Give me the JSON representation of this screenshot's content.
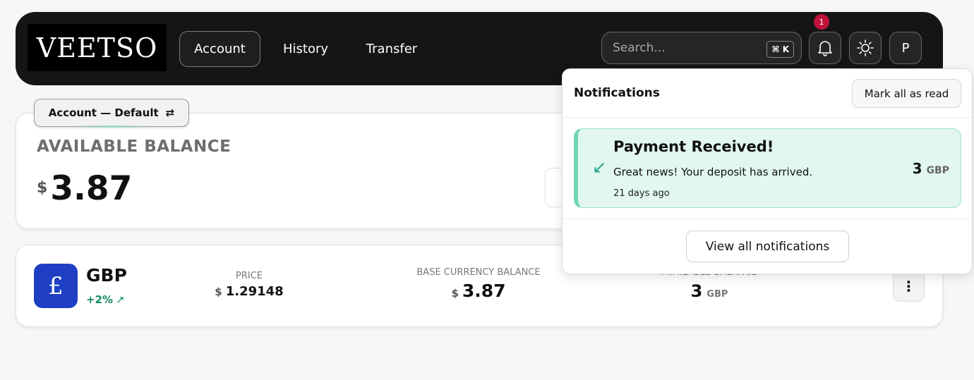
{
  "nav": {
    "logo": "VEETSO",
    "tabs": [
      {
        "label": "Account",
        "active": true
      },
      {
        "label": "History",
        "active": false
      },
      {
        "label": "Transfer",
        "active": false
      }
    ],
    "search": {
      "placeholder": "Search...",
      "shortcut": "⌘ K"
    },
    "notifications_count": "1",
    "avatar_initial": "P",
    "icons": [
      "bell-icon",
      "sun-icon"
    ]
  },
  "account": {
    "selector_label": "Account — Default",
    "switch_icon": "⇄",
    "balance_title": "AVAILABLE BALANCE",
    "currency_symbol": "$",
    "balance_value": "3.87"
  },
  "currency_row": {
    "icon_symbol": "£",
    "code": "GBP",
    "change": "+2%",
    "change_arrow": "↗",
    "price_label": "PRICE",
    "price_currency": "$",
    "price_value": "1.29148",
    "base_label": "BASE CURRENCY BALANCE",
    "base_currency": "$",
    "base_value": "3.87",
    "available_label": "AVAILABLE BALANCE",
    "available_value": "3",
    "available_unit": "GBP",
    "more_icon": "⋮"
  },
  "notifications": {
    "title": "Notifications",
    "mark_all": "Mark all as read",
    "items": [
      {
        "heading": "Payment Received!",
        "message": "Great news! Your deposit has arrived.",
        "time": "21 days ago",
        "amount": "3",
        "unit": "GBP",
        "icon": "↙"
      }
    ],
    "view_all": "View all notifications"
  },
  "colors": {
    "nav_bg": "#151515",
    "accent_green": "#138a5e",
    "notif_bg": "#e1f7ef",
    "gbp_blue": "#1e3fc4",
    "badge_red": "#c1123a"
  }
}
